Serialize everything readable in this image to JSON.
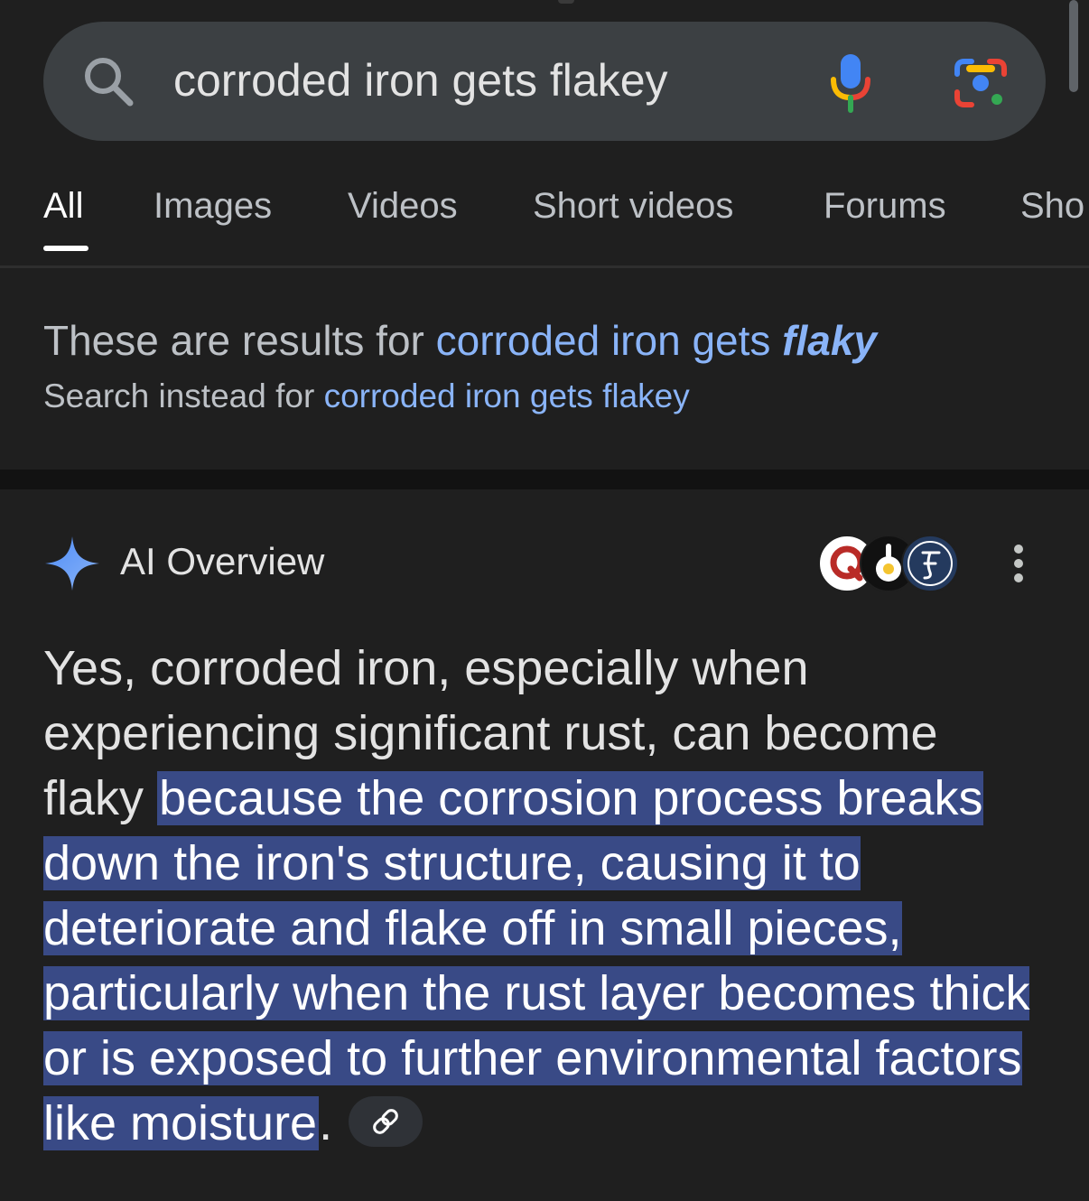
{
  "search": {
    "query": "corroded iron gets flakey",
    "icon": "search-icon",
    "voice_icon": "mic-icon",
    "lens_icon": "lens-icon"
  },
  "tabs": [
    {
      "label": "All",
      "active": true
    },
    {
      "label": "Images",
      "active": false
    },
    {
      "label": "Videos",
      "active": false
    },
    {
      "label": "Short videos",
      "active": false
    },
    {
      "label": "Forums",
      "active": false
    },
    {
      "label": "Sho",
      "active": false
    }
  ],
  "spelling": {
    "prefix": "These are results for",
    "corrected_plain": "corroded iron gets",
    "corrected_bold": "flaky",
    "instead_prefix": "Search instead for",
    "instead_query": "corroded iron gets flakey"
  },
  "ai_overview": {
    "title": "AI Overview",
    "icon": "sparkle-icon",
    "sources": [
      "source-favicon-quora",
      "source-favicon-pan",
      "source-favicon-f"
    ],
    "text_plain": "Yes, corroded iron, especially when experiencing significant rust, can become flaky",
    "text_highlight": "because the corrosion process breaks down the iron's structure, causing it to deteriorate and flake off in small pieces, particularly when the rust layer becomes thick or is exposed to further environmental factors like moisture",
    "text_end": ".",
    "link_icon": "link-icon",
    "more_icon": "more-vert-icon"
  },
  "colors": {
    "background": "#1f1f1f",
    "search_bar": "#3c4043",
    "link": "#8ab4f8",
    "highlight": "#394a86"
  }
}
